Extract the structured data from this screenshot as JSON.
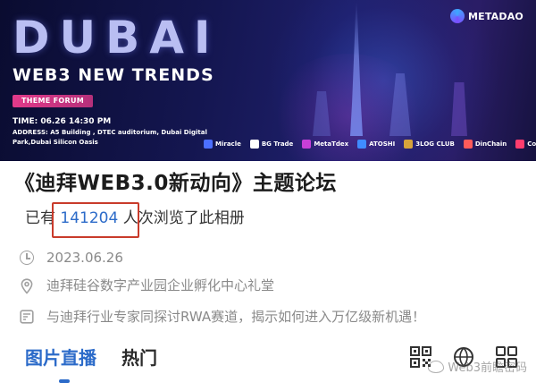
{
  "banner": {
    "title": "DUBAI",
    "subtitle": "WEB3 NEW TRENDS",
    "tag": "THEME FORUM",
    "time": "TIME: 06.26 14:30 PM",
    "address": "ADDRESS:  A5 Building , DTEC auditorium, Dubai Digital Park,Dubai Silicon Oasis",
    "brand": "METADAO",
    "sponsors": [
      {
        "name": "Miracle",
        "color": "#4c6fff"
      },
      {
        "name": "BG Trade",
        "color": "#ffffff"
      },
      {
        "name": "MetaTdex",
        "color": "#c63fd8"
      },
      {
        "name": "ATOSHI",
        "color": "#3f8cff"
      },
      {
        "name": "3LOG CLUB",
        "color": "#d6a33b"
      },
      {
        "name": "DinChain",
        "color": "#ff5a5a"
      },
      {
        "name": "CoinW",
        "color": "#ff3d6e"
      }
    ]
  },
  "album": {
    "title": "《迪拜WEB3.0新动向》主题论坛",
    "views_prefix": "已有",
    "views_count": "141204",
    "views_suffix": "人次浏览了此相册",
    "date": "2023.06.26",
    "place": "迪拜硅谷数字产业园企业孵化中心礼堂",
    "description": "与迪拜行业专家同探讨RWA赛道，揭示如何进入万亿级新机遇！"
  },
  "tabs": [
    {
      "label": "图片直播",
      "active": true
    },
    {
      "label": "热门",
      "active": false
    }
  ],
  "icons": [
    "clock-icon",
    "location-pin-icon",
    "announcement-icon",
    "qr-code-icon",
    "share-icon",
    "grid-icon"
  ],
  "watermark": "Web3前瞻密码",
  "colors": {
    "accent": "#2c6bc9",
    "highlight_box": "#c93b2b",
    "tag": "#e23a8a"
  }
}
